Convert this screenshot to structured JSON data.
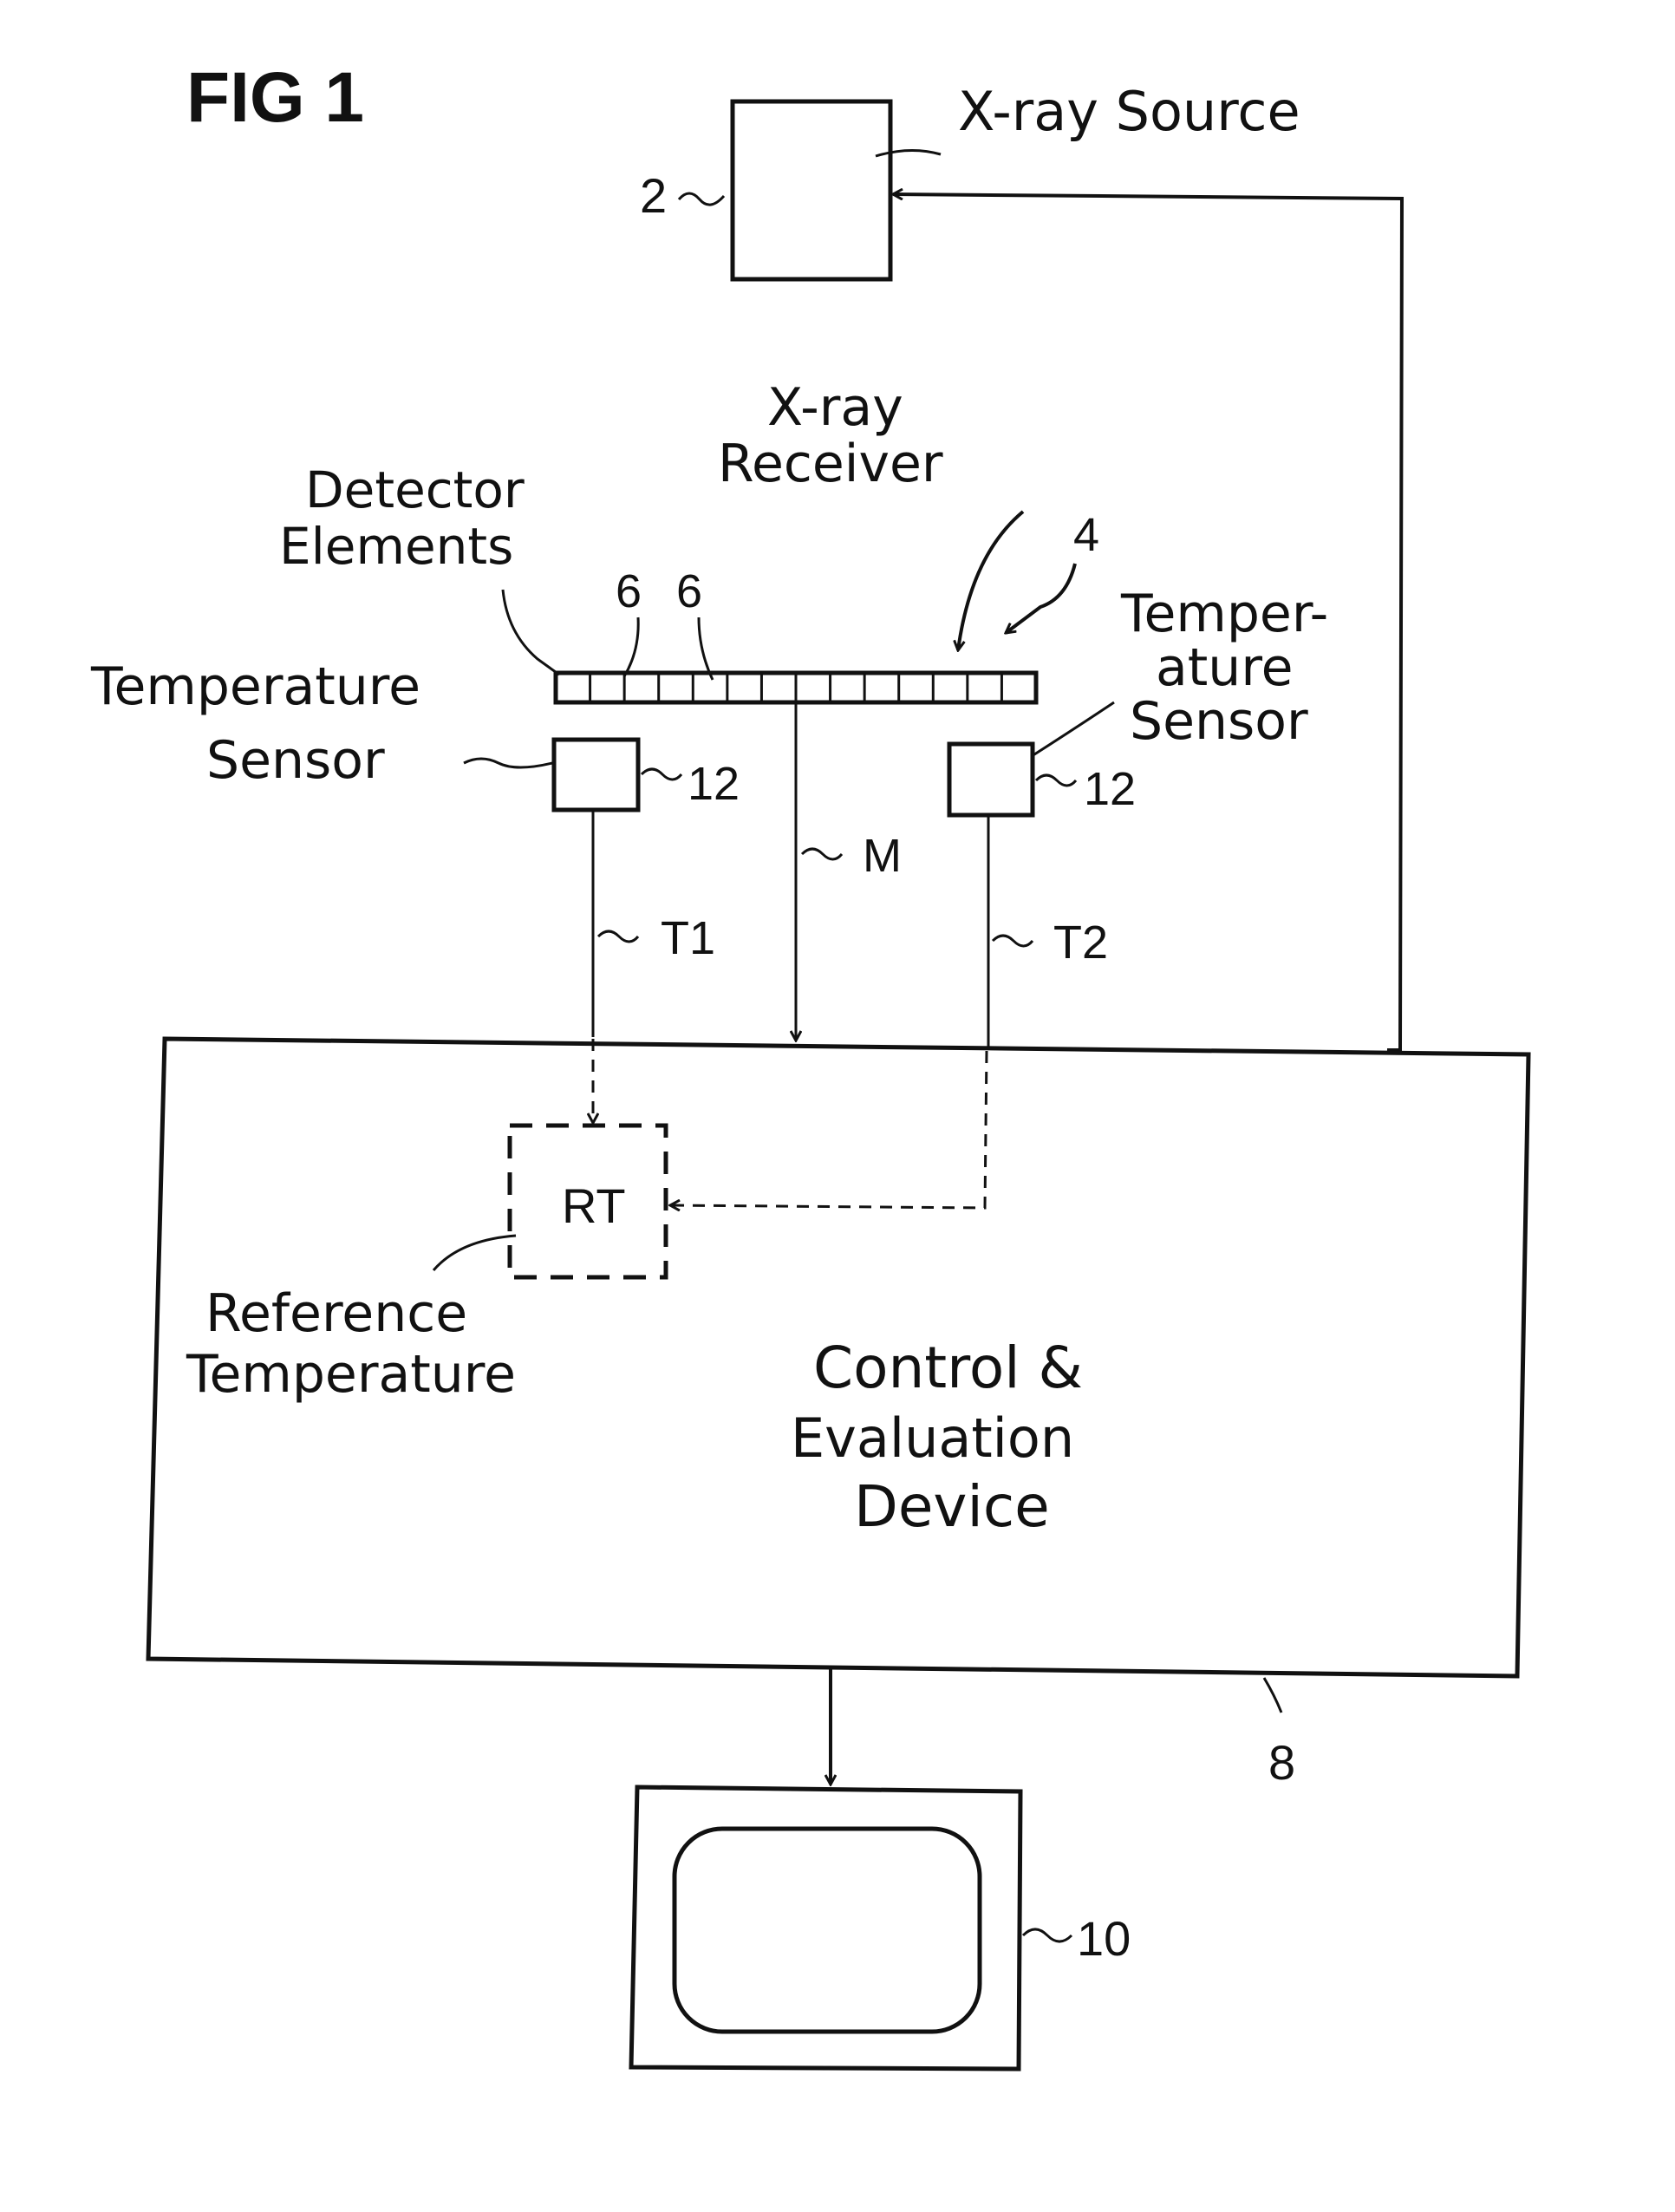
{
  "figure": {
    "title": "FIG 1"
  },
  "components": {
    "xray_source": {
      "label": "X-ray Source",
      "ref": "2"
    },
    "xray_receiver": {
      "label_line1": "X-ray",
      "label_line2": "Receiver",
      "ref": "4",
      "detector_element_count": 14
    },
    "detector_elements": {
      "label_line1": "Detector",
      "label_line2": "Elements",
      "ref_a": "6",
      "ref_b": "6"
    },
    "temperature_sensor_left": {
      "label_line1": "Temperature",
      "label_line2": "Sensor",
      "ref": "12"
    },
    "temperature_sensor_right": {
      "label_line1": "Temper-",
      "label_line2": "ature",
      "label_line3": "Sensor",
      "ref": "12"
    },
    "signals": {
      "measurement": "M",
      "temp1": "T1",
      "temp2": "T2"
    },
    "reference_temperature": {
      "box_text": "RT",
      "label_line1": "Reference",
      "label_line2": "Temperature"
    },
    "control_device": {
      "label_line1": "Control &",
      "label_line2": "Evaluation",
      "label_line3": "Device",
      "ref": "8"
    },
    "monitor": {
      "ref": "10"
    }
  }
}
